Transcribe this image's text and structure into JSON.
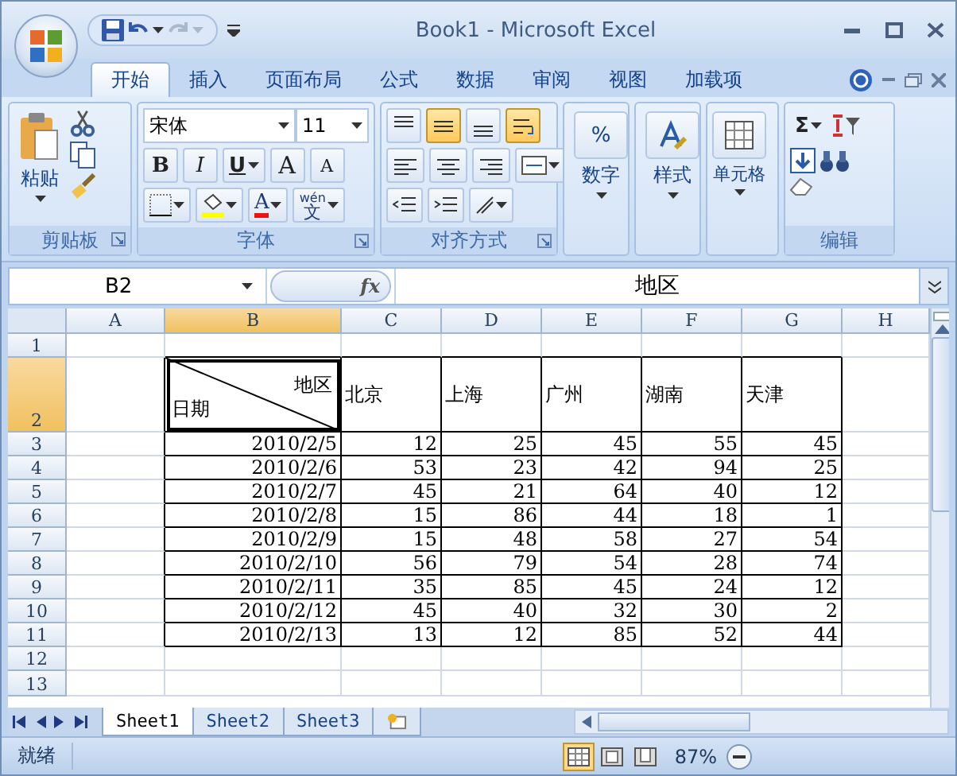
{
  "window": {
    "title": "Book1 - Microsoft Excel"
  },
  "quick_access": [
    {
      "kind": "save",
      "disabled": false
    },
    {
      "kind": "undo",
      "disabled": false
    },
    {
      "kind": "redo",
      "disabled": true
    }
  ],
  "tabs": [
    {
      "label": "开始",
      "selected": true
    },
    {
      "label": "插入",
      "selected": false
    },
    {
      "label": "页面布局",
      "selected": false
    },
    {
      "label": "公式",
      "selected": false
    },
    {
      "label": "数据",
      "selected": false
    },
    {
      "label": "审阅",
      "selected": false
    },
    {
      "label": "视图",
      "selected": false
    },
    {
      "label": "加载项",
      "selected": false
    }
  ],
  "ribbon": {
    "clipboard": {
      "label": "剪贴板",
      "paste": "粘贴"
    },
    "font": {
      "label": "字体",
      "font_name": "宋体",
      "font_size": "11",
      "bold": "B",
      "italic": "I",
      "underline": "U",
      "grow": "A",
      "shrink": "A",
      "font_color": "A",
      "phonetic_top": "wén",
      "phonetic": "文"
    },
    "alignment": {
      "label": "对齐方式",
      "vertical": [
        {
          "kind": "top",
          "selected": false
        },
        {
          "kind": "middle",
          "selected": true
        },
        {
          "kind": "bottom",
          "selected": false
        }
      ],
      "wrap_selected": true
    },
    "number": {
      "label": "数字",
      "symbol": "%"
    },
    "styles": {
      "label": "样式"
    },
    "cells": {
      "label": "单元格"
    },
    "editing": {
      "label": "编辑",
      "sum": "Σ"
    }
  },
  "formula_bar": {
    "name_box": "B2",
    "fx": "fx",
    "content": "地区"
  },
  "sheet": {
    "columns": [
      {
        "label": "A",
        "selected": false
      },
      {
        "label": "B",
        "selected": true
      },
      {
        "label": "C",
        "selected": false
      },
      {
        "label": "D",
        "selected": false
      },
      {
        "label": "E",
        "selected": false
      },
      {
        "label": "F",
        "selected": false
      },
      {
        "label": "G",
        "selected": false
      },
      {
        "label": "H",
        "selected": false
      }
    ],
    "rows": [
      {
        "label": "1",
        "selected": false
      },
      {
        "label": "2",
        "selected": true,
        "cells": [
          {
            "kind": "diagonal",
            "top": "地区",
            "bottom": "日期"
          },
          {
            "kind": "text",
            "text": "北京"
          },
          {
            "kind": "text",
            "text": "上海"
          },
          {
            "kind": "text",
            "text": "广州"
          },
          {
            "kind": "text",
            "text": "湖南"
          },
          {
            "kind": "text",
            "text": "天津"
          }
        ]
      },
      {
        "label": "3",
        "selected": false,
        "cells": [
          {
            "kind": "number",
            "text": "2010/2/5"
          },
          {
            "kind": "number",
            "text": "12"
          },
          {
            "kind": "number",
            "text": "25"
          },
          {
            "kind": "number",
            "text": "45"
          },
          {
            "kind": "number",
            "text": "55"
          },
          {
            "kind": "number",
            "text": "45"
          }
        ]
      },
      {
        "label": "4",
        "selected": false,
        "cells": [
          {
            "kind": "number",
            "text": "2010/2/6"
          },
          {
            "kind": "number",
            "text": "53"
          },
          {
            "kind": "number",
            "text": "23"
          },
          {
            "kind": "number",
            "text": "42"
          },
          {
            "kind": "number",
            "text": "94"
          },
          {
            "kind": "number",
            "text": "25"
          }
        ]
      },
      {
        "label": "5",
        "selected": false,
        "cells": [
          {
            "kind": "number",
            "text": "2010/2/7"
          },
          {
            "kind": "number",
            "text": "45"
          },
          {
            "kind": "number",
            "text": "21"
          },
          {
            "kind": "number",
            "text": "64"
          },
          {
            "kind": "number",
            "text": "40"
          },
          {
            "kind": "number",
            "text": "12"
          }
        ]
      },
      {
        "label": "6",
        "selected": false,
        "cells": [
          {
            "kind": "number",
            "text": "2010/2/8"
          },
          {
            "kind": "number",
            "text": "15"
          },
          {
            "kind": "number",
            "text": "86"
          },
          {
            "kind": "number",
            "text": "44"
          },
          {
            "kind": "number",
            "text": "18"
          },
          {
            "kind": "number",
            "text": "1"
          }
        ]
      },
      {
        "label": "7",
        "selected": false,
        "cells": [
          {
            "kind": "number",
            "text": "2010/2/9"
          },
          {
            "kind": "number",
            "text": "15"
          },
          {
            "kind": "number",
            "text": "48"
          },
          {
            "kind": "number",
            "text": "58"
          },
          {
            "kind": "number",
            "text": "27"
          },
          {
            "kind": "number",
            "text": "54"
          }
        ]
      },
      {
        "label": "8",
        "selected": false,
        "cells": [
          {
            "kind": "number",
            "text": "2010/2/10"
          },
          {
            "kind": "number",
            "text": "56"
          },
          {
            "kind": "number",
            "text": "79"
          },
          {
            "kind": "number",
            "text": "54"
          },
          {
            "kind": "number",
            "text": "28"
          },
          {
            "kind": "number",
            "text": "74"
          }
        ]
      },
      {
        "label": "9",
        "selected": false,
        "cells": [
          {
            "kind": "number",
            "text": "2010/2/11"
          },
          {
            "kind": "number",
            "text": "35"
          },
          {
            "kind": "number",
            "text": "85"
          },
          {
            "kind": "number",
            "text": "45"
          },
          {
            "kind": "number",
            "text": "24"
          },
          {
            "kind": "number",
            "text": "12"
          }
        ]
      },
      {
        "label": "10",
        "selected": false,
        "cells": [
          {
            "kind": "number",
            "text": "2010/2/12"
          },
          {
            "kind": "number",
            "text": "45"
          },
          {
            "kind": "number",
            "text": "40"
          },
          {
            "kind": "number",
            "text": "32"
          },
          {
            "kind": "number",
            "text": "30"
          },
          {
            "kind": "number",
            "text": "2"
          }
        ]
      },
      {
        "label": "11",
        "selected": false,
        "cells": [
          {
            "kind": "number",
            "text": "2010/2/13"
          },
          {
            "kind": "number",
            "text": "13"
          },
          {
            "kind": "number",
            "text": "12"
          },
          {
            "kind": "number",
            "text": "85"
          },
          {
            "kind": "number",
            "text": "52"
          },
          {
            "kind": "number",
            "text": "44"
          }
        ]
      },
      {
        "label": "12",
        "selected": false
      },
      {
        "label": "13",
        "selected": false
      }
    ]
  },
  "sheet_tabs": [
    {
      "label": "Sheet1",
      "selected": true
    },
    {
      "label": "Sheet2",
      "selected": false
    },
    {
      "label": "Sheet3",
      "selected": false
    }
  ],
  "status_bar": {
    "status": "就绪",
    "views": [
      {
        "kind": "normal",
        "selected": true
      },
      {
        "kind": "page_layout",
        "selected": false
      },
      {
        "kind": "page_break",
        "selected": false
      }
    ],
    "zoom": "87%"
  }
}
